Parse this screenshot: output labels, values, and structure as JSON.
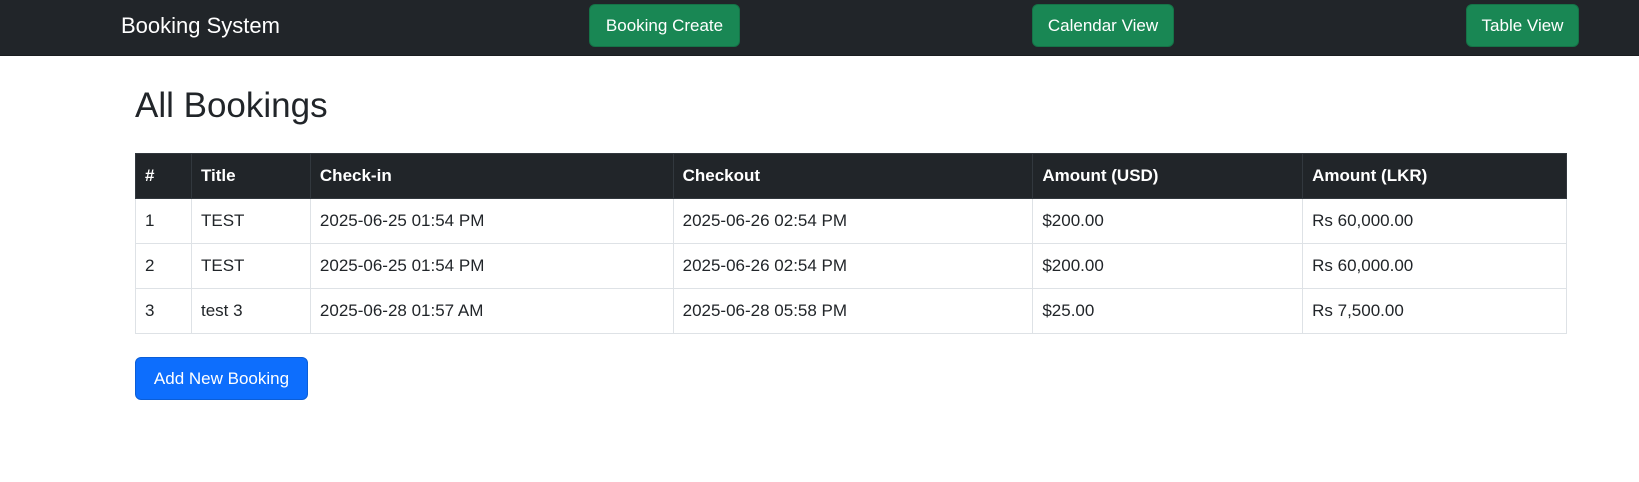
{
  "navbar": {
    "brand": "Booking System",
    "buttons": [
      "Booking Create",
      "Calendar View",
      "Table View"
    ]
  },
  "page": {
    "title": "All Bookings"
  },
  "table": {
    "headers": [
      "#",
      "Title",
      "Check-in",
      "Checkout",
      "Amount (USD)",
      "Amount (LKR)"
    ],
    "rows": [
      [
        "1",
        "TEST",
        "2025-06-25 01:54 PM",
        "2025-06-26 02:54 PM",
        "$200.00",
        "Rs 60,000.00"
      ],
      [
        "2",
        "TEST",
        "2025-06-25 01:54 PM",
        "2025-06-26 02:54 PM",
        "$200.00",
        "Rs 60,000.00"
      ],
      [
        "3",
        "test 3",
        "2025-06-28 01:57 AM",
        "2025-06-28 05:58 PM",
        "$25.00",
        "Rs 7,500.00"
      ]
    ]
  },
  "actions": {
    "add_label": "Add New Booking"
  },
  "colors": {
    "navbar_bg": "#212529",
    "success": "#198754",
    "primary": "#0d6efd"
  }
}
